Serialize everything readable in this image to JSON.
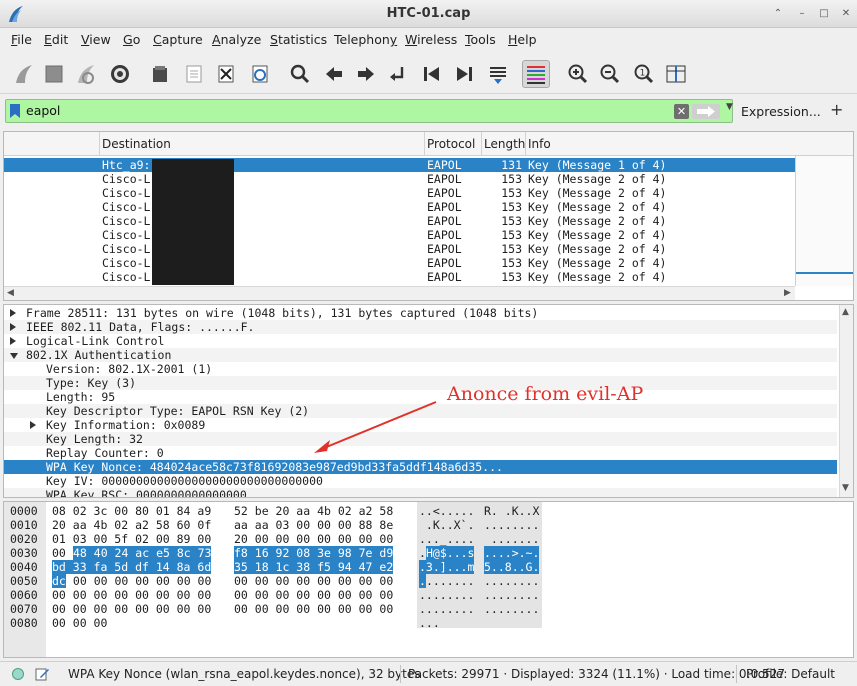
{
  "window": {
    "title": "HTC-01.cap"
  },
  "menu": [
    "File",
    "Edit",
    "View",
    "Go",
    "Capture",
    "Analyze",
    "Statistics",
    "Telephony",
    "Wireless",
    "Tools",
    "Help"
  ],
  "menu_underline": [
    "F",
    "E",
    "V",
    "G",
    "C",
    "A",
    "S",
    "y",
    "W",
    "T",
    "H"
  ],
  "filter": {
    "value": "eapol",
    "expression_label": "Expression...",
    "add_label": "+",
    "clear_label": "✕"
  },
  "packet_list": {
    "columns": [
      "Destination",
      "Protocol",
      "Length",
      "Info"
    ],
    "rows": [
      {
        "destination": "Htc_a9:",
        "protocol": "EAPOL",
        "length": "131",
        "info": "Key (Message 1 of 4)",
        "selected": true
      },
      {
        "destination": "Cisco-L",
        "protocol": "EAPOL",
        "length": "153",
        "info": "Key (Message 2 of 4)"
      },
      {
        "destination": "Cisco-L",
        "protocol": "EAPOL",
        "length": "153",
        "info": "Key (Message 2 of 4)"
      },
      {
        "destination": "Cisco-L",
        "protocol": "EAPOL",
        "length": "153",
        "info": "Key (Message 2 of 4)"
      },
      {
        "destination": "Cisco-L",
        "protocol": "EAPOL",
        "length": "153",
        "info": "Key (Message 2 of 4)"
      },
      {
        "destination": "Cisco-L",
        "protocol": "EAPOL",
        "length": "153",
        "info": "Key (Message 2 of 4)"
      },
      {
        "destination": "Cisco-L",
        "protocol": "EAPOL",
        "length": "153",
        "info": "Key (Message 2 of 4)"
      },
      {
        "destination": "Cisco-L",
        "protocol": "EAPOL",
        "length": "153",
        "info": "Key (Message 2 of 4)"
      },
      {
        "destination": "Cisco-L",
        "protocol": "EAPOL",
        "length": "153",
        "info": "Key (Message 2 of 4)"
      }
    ]
  },
  "packet_details": [
    {
      "text": "Frame 28511: 131 bytes on wire (1048 bits), 131 bytes captured (1048 bits)",
      "level": 0,
      "expander": "right"
    },
    {
      "text": "IEEE 802.11 Data, Flags: ......F.",
      "level": 0,
      "expander": "right"
    },
    {
      "text": "Logical-Link Control",
      "level": 0,
      "expander": "right"
    },
    {
      "text": "802.1X Authentication",
      "level": 0,
      "expander": "down"
    },
    {
      "text": "Version: 802.1X-2001 (1)",
      "level": 1,
      "expander": "none"
    },
    {
      "text": "Type: Key (3)",
      "level": 1,
      "expander": "none"
    },
    {
      "text": "Length: 95",
      "level": 1,
      "expander": "none"
    },
    {
      "text": "Key Descriptor Type: EAPOL RSN Key (2)",
      "level": 1,
      "expander": "none"
    },
    {
      "text": "Key Information: 0x0089",
      "level": 1,
      "expander": "right"
    },
    {
      "text": "Key Length: 32",
      "level": 1,
      "expander": "none"
    },
    {
      "text": "Replay Counter: 0",
      "level": 1,
      "expander": "none"
    },
    {
      "text": "WPA Key Nonce: 484024ace58c73f81692083e987ed9bd33fa5ddf148a6d35...",
      "level": 1,
      "expander": "none",
      "selected": true
    },
    {
      "text": "Key IV: 00000000000000000000000000000000",
      "level": 1,
      "expander": "none"
    },
    {
      "text": "WPA Key RSC: 0000000000000000",
      "level": 1,
      "expander": "none"
    }
  ],
  "annotation": {
    "text": "Anonce from evil-AP",
    "color": "#e0312a"
  },
  "bytes": [
    {
      "offset": "0000",
      "hex_a": "08 02 3c 00 80 01 84 a9",
      "hex_b": "52 be 20 aa 4b 02 a2 58",
      "ascii_a": "..<.....",
      "ascii_b": "R. .K..X"
    },
    {
      "offset": "0010",
      "hex_a": "20 aa 4b 02 a2 58 60 0f",
      "hex_b": "aa aa 03 00 00 00 88 8e",
      "ascii_a": " .K..X`.",
      "ascii_b": "........"
    },
    {
      "offset": "0020",
      "hex_a": "01 03 00 5f 02 00 89 00",
      "hex_b": "20 00 00 00 00 00 00 00",
      "ascii_a": "..._....",
      "ascii_b": " ......."
    },
    {
      "offset": "0030",
      "hex_a_plain": "00",
      "hex_a_hl": "48 40 24 ac e5 8c 73",
      "hex_b": "f8 16 92 08 3e 98 7e d9",
      "ascii_a_plain": ".",
      "ascii_a_hl": "H@$...s",
      "ascii_b": "....>.~."
    },
    {
      "offset": "0040",
      "hex_a": "bd 33 fa 5d df 14 8a 6d",
      "hex_b": "35 18 1c 38 f5 94 47 e2",
      "ascii_a": ".3.]...m",
      "ascii_b": "5..8..G."
    },
    {
      "offset": "0050",
      "hex_a_hl": "dc",
      "hex_a_rest": " 00 00 00 00 00 00 00",
      "hex_b": "00 00 00 00 00 00 00 00",
      "ascii_a_hl": ".",
      "ascii_a_rest": ".......",
      "ascii_b": "........"
    },
    {
      "offset": "0060",
      "hex_a": "00 00 00 00 00 00 00 00",
      "hex_b": "00 00 00 00 00 00 00 00",
      "ascii_a": "........",
      "ascii_b": "........"
    },
    {
      "offset": "0070",
      "hex_a": "00 00 00 00 00 00 00 00",
      "hex_b": "00 00 00 00 00 00 00 00",
      "ascii_a": "........",
      "ascii_b": "........"
    },
    {
      "offset": "0080",
      "hex_a": "00 00 00",
      "hex_b": "",
      "ascii_a": "...",
      "ascii_b": ""
    }
  ],
  "status": {
    "field_info": "WPA Key Nonce (wlan_rsna_eapol.keydes.nonce), 32 bytes",
    "packets": "Packets: 29971 · Displayed: 3324 (11.1%) · Load time: 0:0.527",
    "profile": "Profile: Default"
  },
  "colors": {
    "selection": "#2b83c7",
    "filter_valid": "#aff6a3"
  }
}
